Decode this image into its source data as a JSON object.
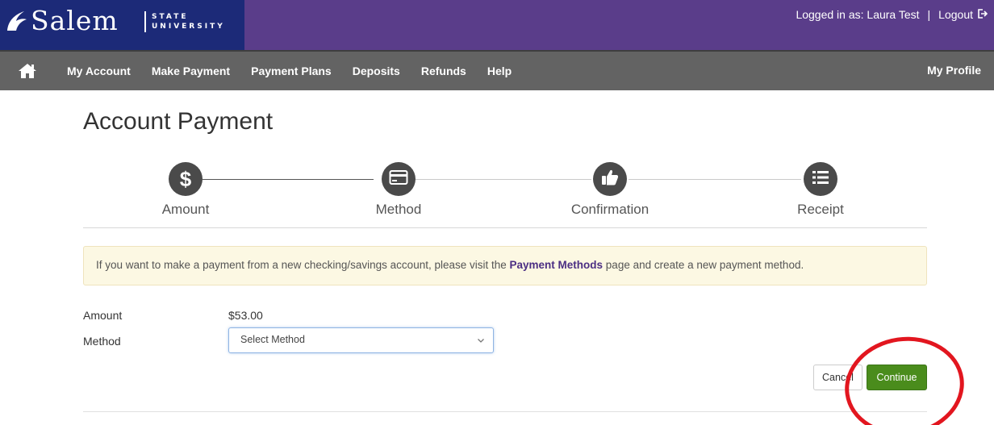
{
  "header": {
    "logo_name": "Salem",
    "logo_line1": "STATE",
    "logo_line2": "UNIVERSITY",
    "logged_in": "Logged in as: Laura Test",
    "separator": "|",
    "logout": "Logout"
  },
  "nav": {
    "home_icon": "home-icon",
    "items": [
      "My Account",
      "Make Payment",
      "Payment Plans",
      "Deposits",
      "Refunds",
      "Help"
    ],
    "profile": "My Profile"
  },
  "page": {
    "title": "Account Payment"
  },
  "stepper": {
    "steps": [
      {
        "label": "Amount",
        "icon": "dollar-icon",
        "glyph": "$"
      },
      {
        "label": "Method",
        "icon": "credit-card-icon"
      },
      {
        "label": "Confirmation",
        "icon": "thumbs-up-icon"
      },
      {
        "label": "Receipt",
        "icon": "list-icon"
      }
    ]
  },
  "alert": {
    "text_before": "If you want to make a payment from a new checking/savings account, please visit the ",
    "link": "Payment Methods",
    "text_after": " page and create a new payment method."
  },
  "form": {
    "amount_label": "Amount",
    "amount_value": "$53.00",
    "method_label": "Method",
    "method_selected": "Select Method"
  },
  "buttons": {
    "cancel": "Cancel",
    "continue": "Continue"
  },
  "colors": {
    "banner": "#5a3d8a",
    "logo_bg": "#1c2a78",
    "nav": "#636363",
    "continue": "#4a8c1c",
    "link": "#4b2e83",
    "annotation": "#e2161f"
  }
}
